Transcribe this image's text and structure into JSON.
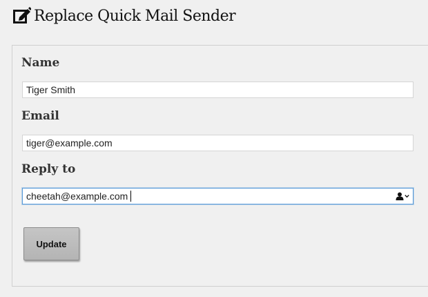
{
  "header": {
    "icon": "edit-square-icon",
    "title": "Replace Quick Mail Sender"
  },
  "form": {
    "name": {
      "label": "Name",
      "value": "Tiger Smith"
    },
    "email": {
      "label": "Email",
      "value": "tiger@example.com"
    },
    "reply_to": {
      "label": "Reply to",
      "value": "cheetah@example.com",
      "contacts_icon": "contact-person-icon",
      "dropdown_icon": "chevron-down-icon"
    },
    "update_label": "Update"
  },
  "colors": {
    "background": "#f0f0f0",
    "focus_border": "#5a9bd8",
    "button_fill": "#bdbdbd"
  }
}
